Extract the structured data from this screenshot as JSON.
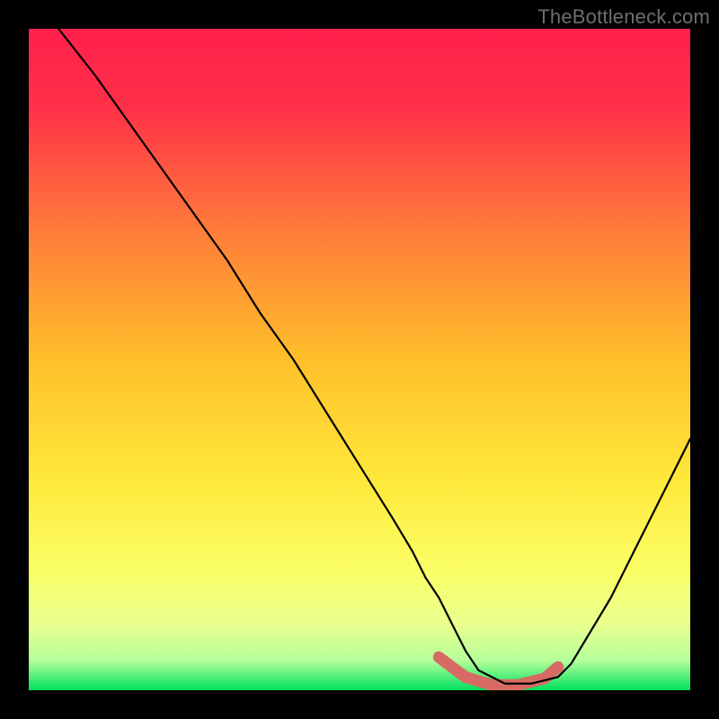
{
  "watermark": {
    "text": "TheBottleneck.com"
  },
  "chart_data": {
    "type": "line",
    "title": "",
    "xlabel": "",
    "ylabel": "",
    "xlim": [
      0,
      100
    ],
    "ylim": [
      0,
      100
    ],
    "grid": false,
    "legend": false,
    "background_gradient": {
      "top_color": "#ff1f4b",
      "mid_color": "#ffe500",
      "bottom_color": "#00e060"
    },
    "curve_description": "V-shaped bottleneck curve; steep descent from top-left, minimum plateau ~68–80% of x at y≈0, rises again toward right edge",
    "series": [
      {
        "name": "bottleneck-curve",
        "color": "#000000",
        "x": [
          4.5,
          10,
          15,
          20,
          25,
          30,
          35,
          40,
          45,
          50,
          55,
          58,
          60,
          62,
          64,
          66,
          68,
          72,
          76,
          80,
          82,
          85,
          88,
          92,
          96,
          100
        ],
        "y": [
          100,
          93,
          86,
          79,
          72,
          65,
          57,
          50,
          42,
          34,
          26,
          21,
          17,
          14,
          10,
          6,
          3,
          1,
          1,
          2,
          4,
          9,
          14,
          22,
          30,
          38
        ]
      }
    ],
    "highlight_segment": {
      "name": "min-plateau",
      "color": "#d76b63",
      "x": [
        62,
        66,
        70,
        74,
        78,
        80
      ],
      "y": [
        5,
        2,
        0.8,
        0.8,
        1.8,
        3.5
      ]
    }
  }
}
